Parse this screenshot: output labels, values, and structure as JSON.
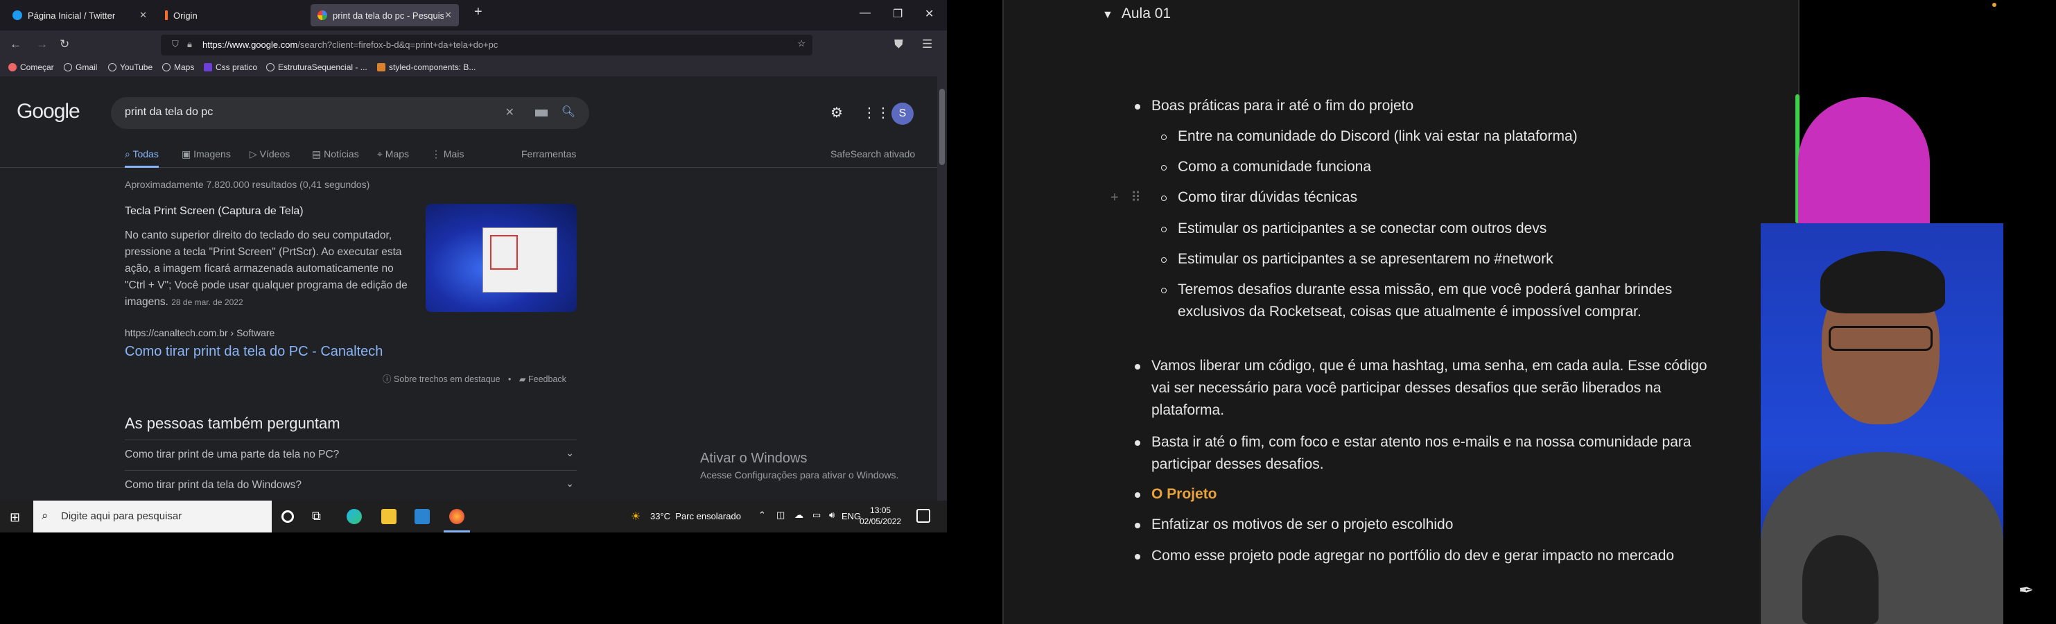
{
  "browser": {
    "tabs": [
      {
        "label": "Página Inicial / Twitter",
        "active": false
      },
      {
        "label": "Origin",
        "active": false
      },
      {
        "label": "print da tela do pc - Pesquisa G",
        "active": true
      }
    ],
    "new_tab_glyph": "+",
    "url_domain": "https://www.google.com",
    "url_path": "/search?client=firefox-b-d&q=print+da+tela+do+pc",
    "bookmarks": [
      "Começar",
      "Gmail",
      "YouTube",
      "Maps",
      "Css pratico",
      "EstruturaSequencial - ...",
      "styled-components: B..."
    ]
  },
  "google": {
    "logo": "Google",
    "query": "print da tela do pc",
    "avatar_letter": "S",
    "tabs": [
      "Todas",
      "Imagens",
      "Vídeos",
      "Notícias",
      "Maps",
      "Mais"
    ],
    "tools": "Ferramentas",
    "safesearch": "SafeSearch ativado",
    "stats": "Aproximadamente 7.820.000 resultados (0,41 segundos)",
    "snippet_title": "Tecla Print Screen (Captura de Tela)",
    "snippet_body": "No canto superior direito do teclado do seu computador, pressione a tecla \"Print Screen\" (PrtScr). Ao executar esta ação, a imagem ficará armazenada automaticamente no \"Ctrl + V\"; Você pode usar qualquer programa de edição de imagens.",
    "snippet_date": "28 de mar. de 2022",
    "result_url": "https://canaltech.com.br › Software",
    "result_title": "Como tirar print da tela do PC - Canaltech",
    "about_snippets": "Sobre trechos em destaque",
    "feedback": "Feedback",
    "paa_title": "As pessoas também perguntam",
    "paa_items": [
      "Como tirar print de uma parte da tela no PC?",
      "Como tirar print da tela do Windows?"
    ],
    "activate_title": "Ativar o Windows",
    "activate_sub": "Acesse Configurações para ativar o Windows."
  },
  "taskbar": {
    "search_placeholder": "Digite aqui para pesquisar",
    "weather": "33°C  Parc ensolarado",
    "lang": "ENG",
    "time": "13:05",
    "date": "02/05/2022"
  },
  "notes": {
    "toggle_title": "Aula 01",
    "items": [
      {
        "text": "Boas práticas para ir até o fim do projeto",
        "level": 0
      },
      {
        "text": "Entre na comunidade do Discord (link vai estar na plataforma)",
        "level": 1
      },
      {
        "text": "Como a comunidade funciona",
        "level": 1
      },
      {
        "text": "Como tirar dúvidas técnicas",
        "level": 1
      },
      {
        "text": "Estimular os participantes a se conectar com outros devs",
        "level": 1
      },
      {
        "text": "Estimular os participantes a se apresentarem no #network",
        "level": 1
      },
      {
        "text": "Teremos desafios durante essa missão, em que você poderá ganhar brindes exclusivos da Rocketseat, coisas que atualmente é impossível comprar.",
        "level": 1
      },
      {
        "text": "Vamos liberar um código, que é uma hashtag, uma senha, em cada aula. Esse código vai ser necessário para você participar desses desafios que serão liberados na plataforma.",
        "level": 0
      },
      {
        "text": "Basta ir até o fim, com foco e estar atento nos e-mails e na nossa comunidade para participar desses desafios.",
        "level": 0
      },
      {
        "text": "O Projeto",
        "level": 0,
        "highlight": "#e8a33c"
      },
      {
        "text": "Enfatizar os motivos de ser o projeto escolhido",
        "level": 0
      },
      {
        "text": "Como esse projeto pode agregar no portfólio do dev e gerar impacto no mercado",
        "level": 0
      }
    ]
  }
}
